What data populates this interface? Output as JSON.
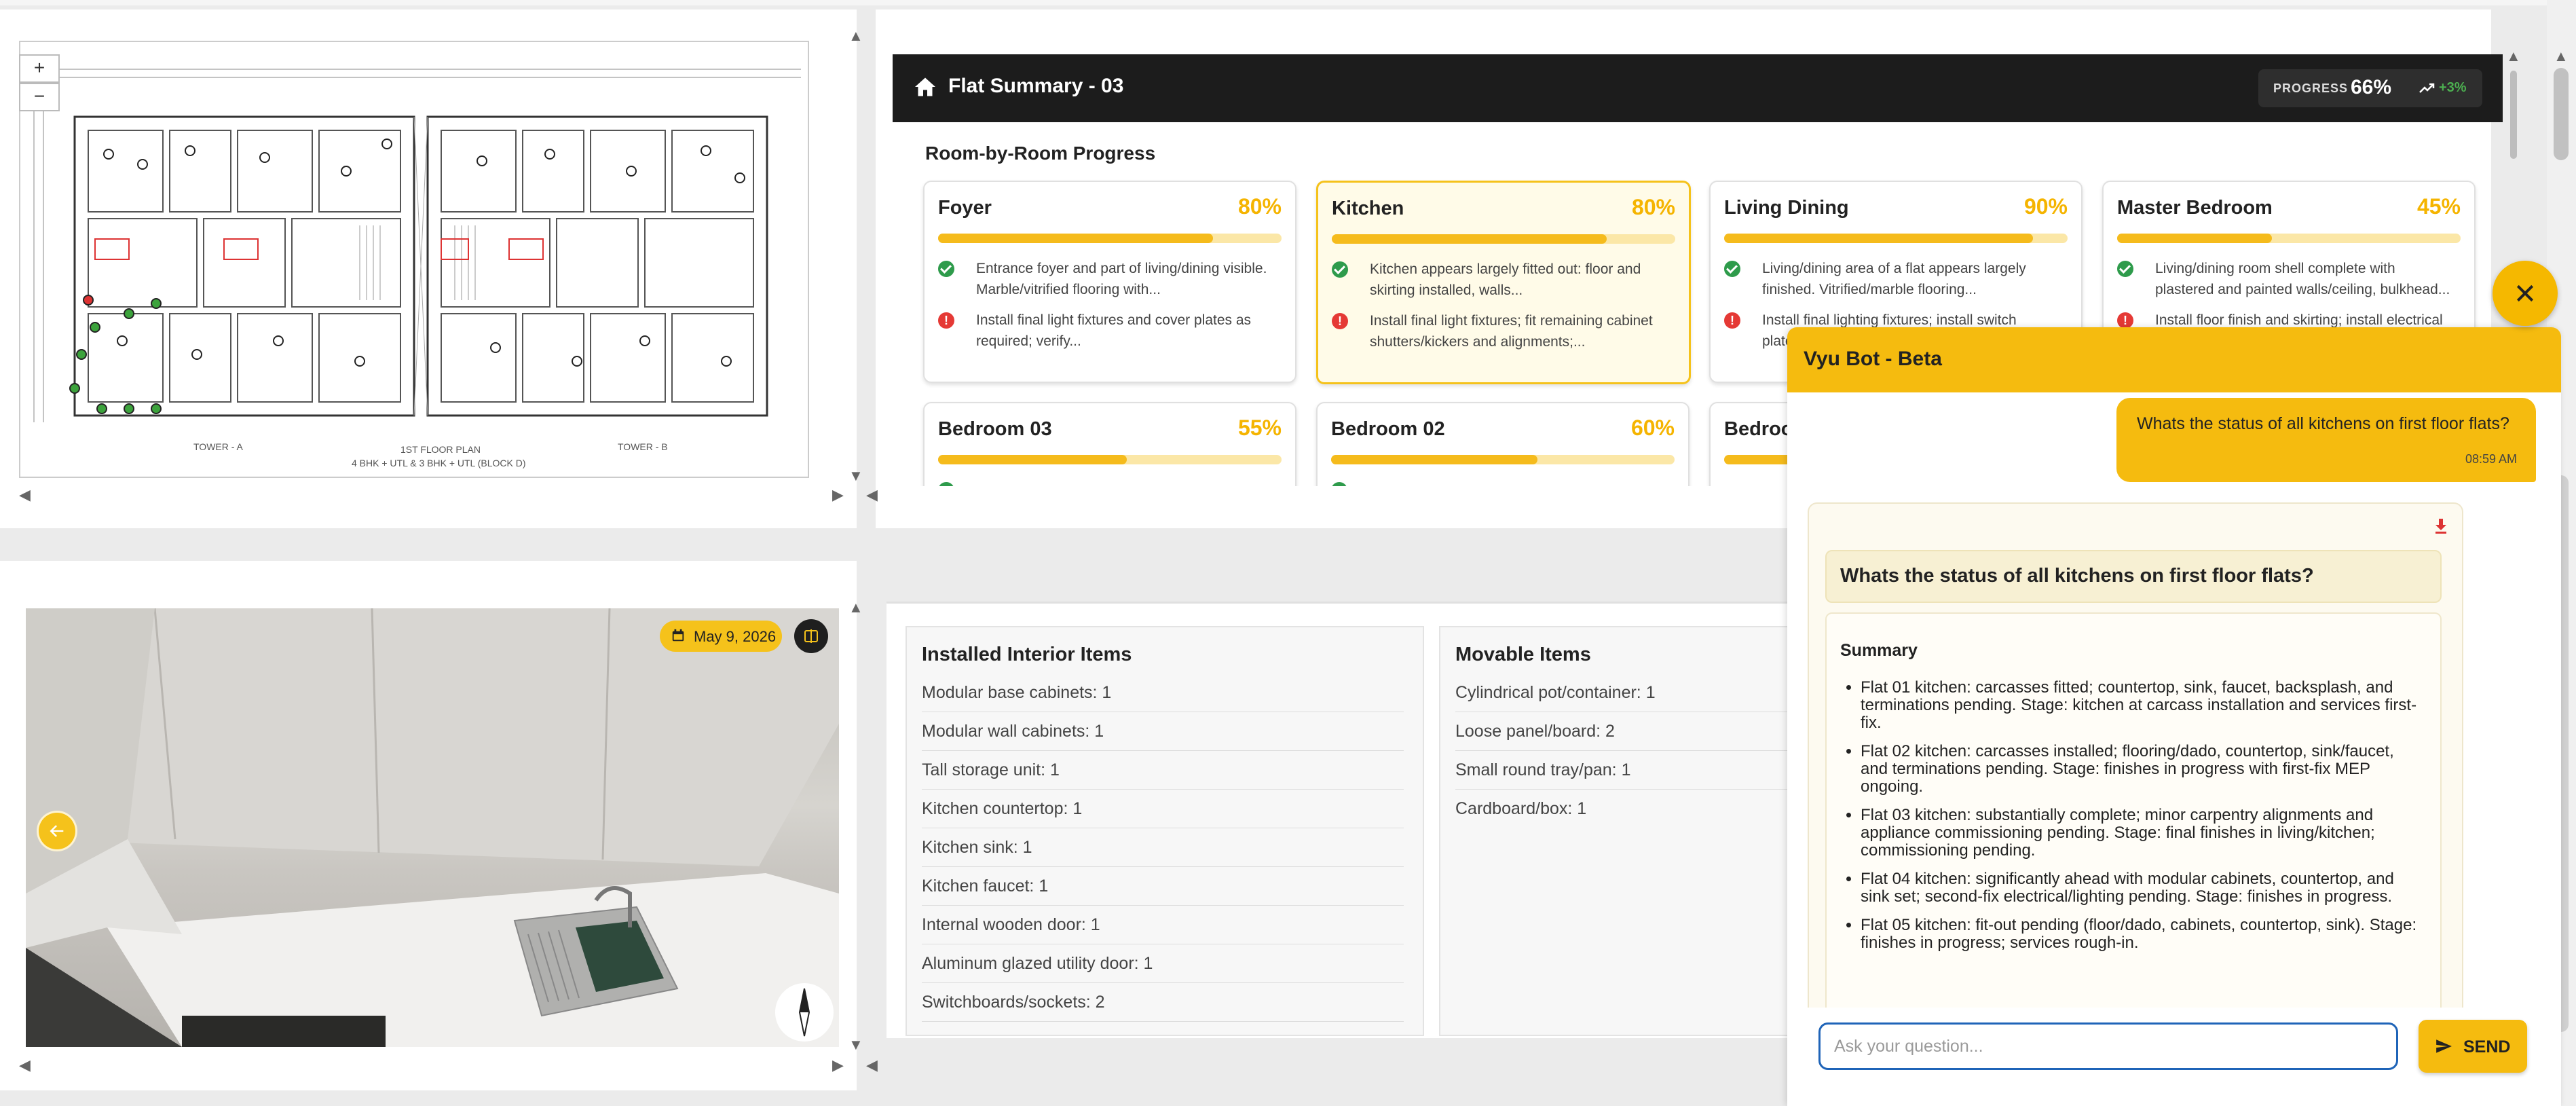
{
  "plan": {
    "zoom_in": "+",
    "zoom_out": "−",
    "caption_left": "TOWER - A",
    "caption_right": "TOWER - B",
    "caption_center": "1ST FLOOR PLAN",
    "caption_sub": "4 BHK + UTL & 3 BHK + UTL (BLOCK D)"
  },
  "summary": {
    "title": "Flat Summary - 03",
    "progress_label": "PROGRESS",
    "progress_value": "66%",
    "progress_trend": "+3%",
    "section_title": "Room-by-Room Progress",
    "rooms": [
      {
        "name": "Foyer",
        "pct": "80%",
        "fill": 0.8,
        "ok": "Entrance foyer and part of living/dining visible. Marble/vitrified flooring with...",
        "todo": "Install final light fixtures and cover plates as required; verify..."
      },
      {
        "name": "Kitchen",
        "pct": "80%",
        "fill": 0.8,
        "ok": "Kitchen appears largely fitted out: floor and skirting installed, walls...",
        "todo": "Install final light fixtures; fit remaining cabinet shutters/kickers and alignments;..."
      },
      {
        "name": "Living Dining",
        "pct": "90%",
        "fill": 0.9,
        "ok": "Living/dining area of a flat appears largely finished. Vitrified/marble flooring...",
        "todo": "Install final lighting fixtures; install switch plate..."
      },
      {
        "name": "Master Bedroom",
        "pct": "45%",
        "fill": 0.45,
        "ok": "Living/dining room shell complete with plastered and painted walls/ceiling, bulkhead...",
        "todo": "Install floor finish and skirting; install electrical"
      },
      {
        "name": "Bedroom 03",
        "pct": "55%",
        "fill": 0.55
      },
      {
        "name": "Bedroom 02",
        "pct": "60%",
        "fill": 0.6
      },
      {
        "name": "Bedroom",
        "pct": "",
        "fill": 0.5
      }
    ]
  },
  "photo": {
    "date": "May 9, 2026"
  },
  "installed": {
    "title": "Installed Interior Items",
    "items": [
      "Modular base cabinets: 1",
      "Modular wall cabinets: 1",
      "Tall storage unit: 1",
      "Kitchen countertop: 1",
      "Kitchen sink: 1",
      "Kitchen faucet: 1",
      "Internal wooden door: 1",
      "Aluminum glazed utility door: 1",
      "Switchboards/sockets: 2"
    ]
  },
  "movable": {
    "title": "Movable Items",
    "items": [
      "Cylindrical pot/container: 1",
      "Loose panel/board: 2",
      "Small round tray/pan: 1",
      "Cardboard/box: 1"
    ]
  },
  "chat": {
    "title": "Vyu Bot - Beta",
    "user_message": "Whats the status of all kitchens on first floor flats?",
    "user_time": "08:59 AM",
    "bot_question": "Whats the status of all kitchens on first floor flats?",
    "bot_summary_title": "Summary",
    "bot_points": [
      "Flat 01 kitchen: carcasses fitted; countertop, sink, faucet, backsplash, and terminations pending. Stage: kitchen at carcass installation and services first-fix.",
      "Flat 02 kitchen: carcasses installed; flooring/dado, countertop, sink/faucet, and terminations pending. Stage: finishes in progress with first-fix MEP ongoing.",
      "Flat 03 kitchen: substantially complete; minor carpentry alignments and appliance commissioning pending. Stage: final finishes in living/kitchen; commissioning pending.",
      "Flat 04 kitchen: significantly ahead with modular cabinets, countertop, and sink set; second-fix electrical/lighting pending. Stage: finishes in progress.",
      "Flat 05 kitchen: fit-out pending (floor/dado, cabinets, countertop, sink). Stage: finishes in progress; services rough-in."
    ],
    "input_placeholder": "Ask your question...",
    "send_label": "SEND"
  },
  "colors": {
    "accent": "#f5bb0f",
    "header_dark": "#1c1c1c",
    "ok_green": "#2e9b4b",
    "alert_red": "#e53935",
    "input_border": "#1f64b8"
  }
}
